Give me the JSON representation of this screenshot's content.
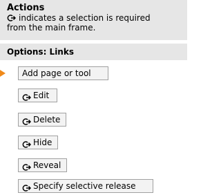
{
  "actions": {
    "title": "Actions",
    "note_line1": "indicates a selection is required",
    "note_line2": "from the main frame."
  },
  "options": {
    "title": "Options: Links"
  },
  "buttons": {
    "add_page": "Add page or tool",
    "edit": "Edit",
    "delete": "Delete",
    "hide": "Hide",
    "reveal": "Reveal",
    "specify_release": "Specify selective release"
  },
  "colors": {
    "header_bg": "#e6e6e6",
    "accent_arrow": "#f08a1a"
  },
  "icons": {
    "selection_required": "selection-arrow-icon",
    "pointer": "pointer-arrow-icon"
  }
}
